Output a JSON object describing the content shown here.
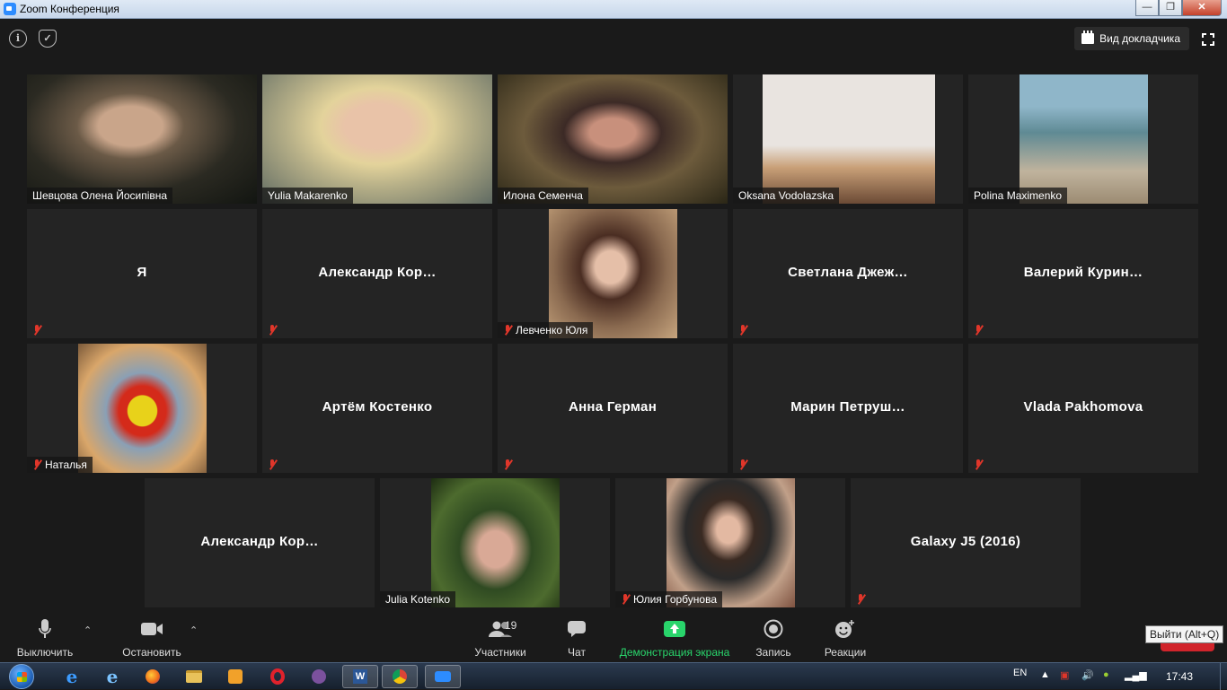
{
  "window": {
    "title": "Zoom Конференция"
  },
  "top_bar": {
    "speaker_view_label": "Вид докладчика"
  },
  "tiles": [
    {
      "name": "Шевцова Олена Йосипівна",
      "video": true,
      "muted": false,
      "active": true
    },
    {
      "name": "Yulia Makarenko",
      "video": true,
      "muted": false
    },
    {
      "name": "Илона Семенча",
      "video": true,
      "muted": false
    },
    {
      "name": "Oksana Vodolazska",
      "video": true,
      "muted": false
    },
    {
      "name": "Polina Maximenko",
      "video": true,
      "muted": false
    },
    {
      "name": "Я",
      "video": false,
      "muted": true
    },
    {
      "name": "Александр  Кор…",
      "video": false,
      "muted": true
    },
    {
      "name": "Левченко Юля",
      "video": true,
      "muted": true
    },
    {
      "name": "Светлана  Джеж…",
      "video": false,
      "muted": true
    },
    {
      "name": "Валерий  Курин…",
      "video": false,
      "muted": true
    },
    {
      "name": "Наталья",
      "video": true,
      "muted": true
    },
    {
      "name": "Артём Костенко",
      "video": false,
      "muted": true
    },
    {
      "name": "Анна Герман",
      "video": false,
      "muted": true
    },
    {
      "name": "Марин  Петруш…",
      "video": false,
      "muted": true
    },
    {
      "name": "Vlada Pakhomova",
      "video": false,
      "muted": true
    },
    {
      "name": "Александр  Кор…",
      "video": false,
      "muted": false
    },
    {
      "name": "Julia Kotenko",
      "video": true,
      "muted": false
    },
    {
      "name": "Юлия Горбунова",
      "video": true,
      "muted": true
    },
    {
      "name": "Galaxy J5 (2016)",
      "video": false,
      "muted": true
    }
  ],
  "toolbar": {
    "mute_label": "Выключить звук",
    "video_label": "Остановить видео",
    "participants_label": "Участники",
    "participants_count": "19",
    "chat_label": "Чат",
    "share_label": "Демонстрация экрана",
    "record_label": "Запись",
    "reactions_label": "Реакции",
    "leave_tooltip": "Выйти (Alt+Q)"
  },
  "taskbar": {
    "language": "EN",
    "clock": "17:43"
  },
  "colors": {
    "active_speaker_border": "#d9e57a",
    "share_green": "#29d46b",
    "mute_red": "#e0362a",
    "leave_red": "#d1242b"
  }
}
